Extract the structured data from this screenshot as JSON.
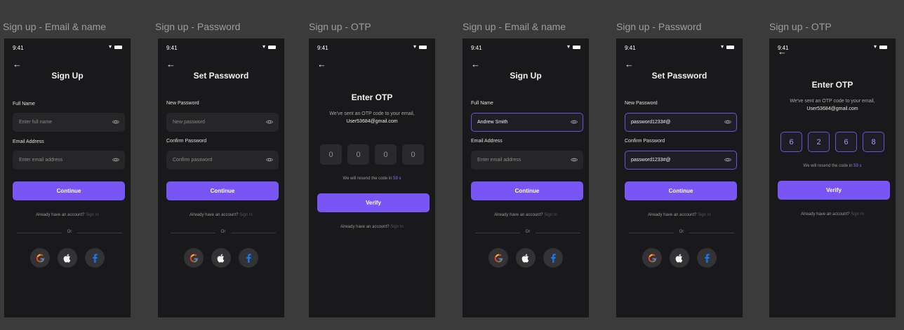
{
  "status_time": "9:41",
  "labels": {
    "full_name": "Full Name",
    "email": "Email Address",
    "new_password": "New Password",
    "confirm_password": "Confirm Password"
  },
  "titles": {
    "sign_up": "Sign Up",
    "set_password": "Set Password",
    "enter_otp": "Enter OTP"
  },
  "placeholders": {
    "full_name": "Enter full name",
    "email": "Enter email address",
    "new_password": "New password",
    "confirm_password": "Confirm password"
  },
  "buttons": {
    "continue": "Continue",
    "verify": "Verify"
  },
  "account": {
    "text": "Already have an account?",
    "link": "Sign In"
  },
  "divider": "Or",
  "otp": {
    "sent_message": "We've sent an OTP code to your email,",
    "email": "User53684@gmail.com",
    "resend_prefix": "We will resend the code in",
    "resend_seconds": "59 s",
    "empty_digits": [
      "0",
      "0",
      "0",
      "0"
    ],
    "filled_digits": [
      "6",
      "2",
      "6",
      "8"
    ]
  },
  "filled": {
    "full_name": "Andrew Smith",
    "new_password": "password1233#@",
    "confirm_password": "password1233#@"
  },
  "frames": [
    {
      "label": "Sign up - Email & name"
    },
    {
      "label": "Sign up - Password"
    },
    {
      "label": "Sign up - OTP"
    },
    {
      "label": "Sign up - Email & name"
    },
    {
      "label": "Sign up - Password"
    },
    {
      "label": "Sign up - OTP"
    }
  ],
  "colors": {
    "accent": "#7a55f5",
    "background": "#3b3b3b",
    "screen": "#19191b"
  },
  "icons": {
    "back": "arrow-left-icon",
    "eye": "eye-icon",
    "google": "google-icon",
    "apple": "apple-icon",
    "facebook": "facebook-icon"
  }
}
